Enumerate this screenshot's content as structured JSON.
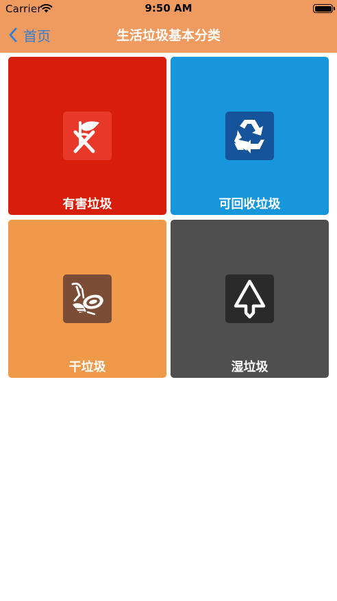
{
  "status_bar": {
    "carrier": "Carrier",
    "time": "9:50 AM"
  },
  "nav": {
    "back_label": "首页",
    "title": "生活垃圾基本分类",
    "background": "#ef9a5f",
    "back_color": "#2f7fd6"
  },
  "categories": [
    {
      "label": "有害垃圾",
      "color": "#d71e0a",
      "icon_bg": "#e8382a",
      "icon": "hazardous-waste-icon"
    },
    {
      "label": "可回收垃圾",
      "color": "#1796dc",
      "icon_bg": "#15549a",
      "icon": "recycle-icon"
    },
    {
      "label": "干垃圾",
      "color": "#ef9a4a",
      "icon_bg": "#7c4d36",
      "icon": "dry-waste-icon"
    },
    {
      "label": "湿垃圾",
      "color": "#4f4f4f",
      "icon_bg": "#2a2a2a",
      "icon": "wet-waste-icon"
    }
  ]
}
